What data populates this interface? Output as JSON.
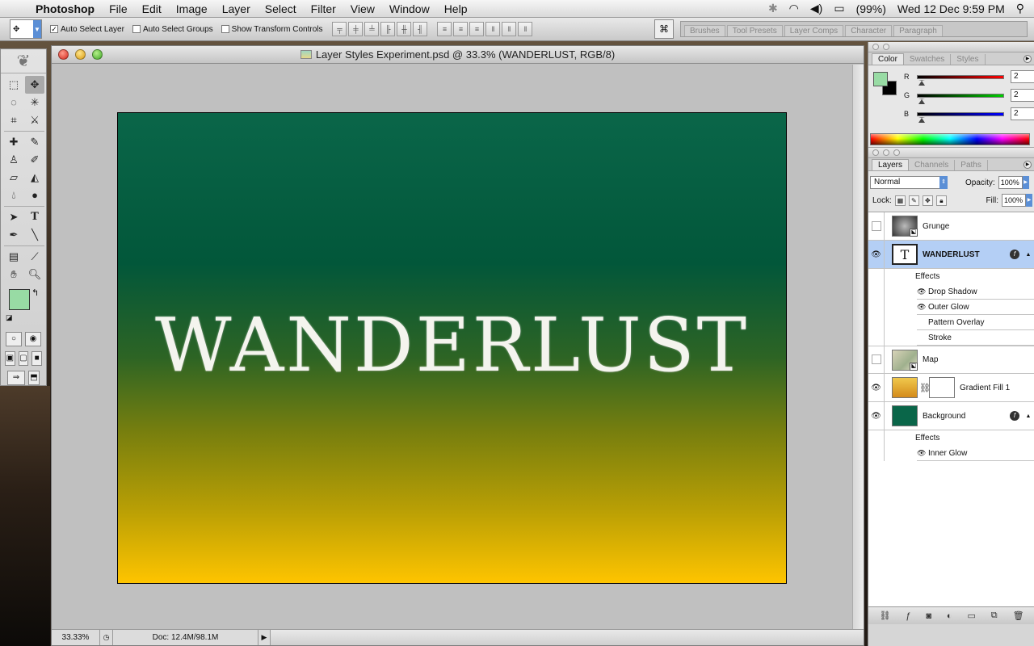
{
  "menubar": {
    "app_name": "Photoshop",
    "menus": [
      "File",
      "Edit",
      "Image",
      "Layer",
      "Select",
      "Filter",
      "View",
      "Window",
      "Help"
    ],
    "battery": "(99%)",
    "clock": "Wed 12 Dec  9:59 PM"
  },
  "options": {
    "auto_select_layer": "Auto Select Layer",
    "auto_select_groups": "Auto Select Groups",
    "show_transform_controls": "Show Transform Controls",
    "palette_well": [
      "Brushes",
      "Tool Presets",
      "Layer Comps",
      "Character",
      "Paragraph"
    ]
  },
  "document": {
    "title": "Layer Styles Experiment.psd @ 33.3% (WANDERLUST, RGB/8)",
    "canvas_text": "WANDERLUST",
    "zoom": "33.33%",
    "doc_info": "Doc: 12.4M/98.1M"
  },
  "color_panel": {
    "tabs": [
      "Color",
      "Swatches",
      "Styles"
    ],
    "sliders": [
      {
        "label": "R",
        "value": "2",
        "track_color": "#ff0000"
      },
      {
        "label": "G",
        "value": "2",
        "track_color": "#00cc00"
      },
      {
        "label": "B",
        "value": "2",
        "track_color": "#0000ff"
      }
    ],
    "foreground": "#98dba4",
    "background": "#000000"
  },
  "layers_panel": {
    "tabs": [
      "Layers",
      "Channels",
      "Paths"
    ],
    "blend_mode": "Normal",
    "opacity_label": "Opacity:",
    "opacity": "100%",
    "lock_label": "Lock:",
    "fill_label": "Fill:",
    "fill": "100%",
    "layers": [
      {
        "name": "Grunge"
      },
      {
        "name": "WANDERLUST"
      },
      {
        "name": "Map"
      },
      {
        "name": "Gradient Fill 1"
      },
      {
        "name": "Background"
      }
    ],
    "wanderlust_effects_label": "Effects",
    "wanderlust_effects": [
      "Drop Shadow",
      "Outer Glow",
      "Pattern Overlay",
      "Stroke"
    ],
    "background_effects_label": "Effects",
    "background_effects": [
      "Inner Glow"
    ]
  }
}
